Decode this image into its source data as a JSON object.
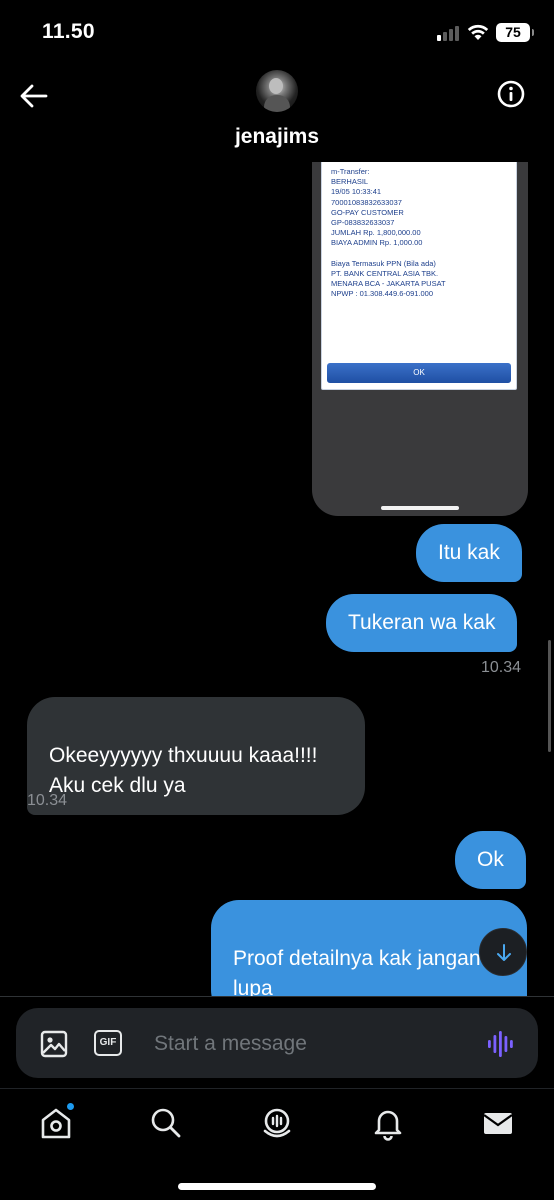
{
  "status_bar": {
    "time": "11.50",
    "battery": "75"
  },
  "header": {
    "username": "jenajims"
  },
  "receipt": {
    "lines": [
      "m-Transfer:",
      "BERHASIL",
      "19/05 10:33:41",
      "700010838326330​37",
      "GO-PAY CUSTOMER",
      "GP-083832633037",
      "JUMLAH Rp. 1,800,000.00",
      "BIAYA ADMIN Rp. 1,000.00",
      "",
      "Biaya Termasuk PPN (Bila ada)",
      "PT. BANK CENTRAL ASIA TBK.",
      "MENARA BCA - JAKARTA PUSAT",
      "NPWP : 01.308.449.6-091.000"
    ],
    "ok_label": "OK"
  },
  "messages": [
    {
      "text": "Itu kak"
    },
    {
      "text": "Tukeran wa kak"
    },
    {
      "time": "10.34"
    },
    {
      "text": "Okeeyyyyyy thxuuuu kaaa!!!!\nAku cek dlu ya"
    },
    {
      "time": "10.34"
    },
    {
      "text": "Ok"
    },
    {
      "text": "Proof detailnya kak jangan\nlupa"
    }
  ],
  "composer": {
    "placeholder": "Start a message"
  },
  "icons": {
    "back": "arrow-left-icon",
    "info": "info-icon",
    "photo": "image-icon",
    "gif": "GIF",
    "voice": "voice-wave-icon",
    "jump": "arrow-down-icon",
    "tabs": [
      "home-icon",
      "search-icon",
      "spaces-icon",
      "bell-icon",
      "mail-icon"
    ]
  },
  "colors": {
    "sent_bubble": "#3a92de",
    "received_bubble": "#2f3336",
    "accent": "#1d9bf0",
    "voice": "#7b61ff"
  }
}
